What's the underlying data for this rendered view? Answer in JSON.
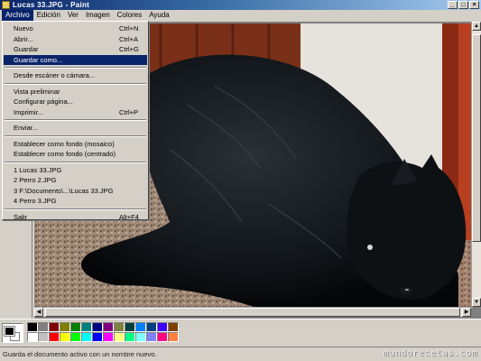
{
  "window": {
    "title": "Lucas 33.JPG - Paint",
    "minimize": "_",
    "maximize": "□",
    "close": "×"
  },
  "menubar": [
    "Archivo",
    "Edición",
    "Ver",
    "Imagen",
    "Colores",
    "Ayuda"
  ],
  "file_menu": {
    "items": [
      {
        "label": "Nuevo",
        "shortcut": "Ctrl+N"
      },
      {
        "label": "Abrir...",
        "shortcut": "Ctrl+A"
      },
      {
        "label": "Guardar",
        "shortcut": "Ctrl+G"
      },
      {
        "label": "Guardar como...",
        "shortcut": "",
        "highlight": true
      },
      {
        "sep": true
      },
      {
        "label": "Desde escáner o cámara...",
        "shortcut": ""
      },
      {
        "sep": true
      },
      {
        "label": "Vista preliminar",
        "shortcut": ""
      },
      {
        "label": "Configurar página...",
        "shortcut": ""
      },
      {
        "label": "Imprimir...",
        "shortcut": "Ctrl+P"
      },
      {
        "sep": true
      },
      {
        "label": "Enviar...",
        "shortcut": ""
      },
      {
        "sep": true
      },
      {
        "label": "Establecer como fondo (mosaico)",
        "shortcut": ""
      },
      {
        "label": "Establecer como fondo (centrado)",
        "shortcut": ""
      },
      {
        "sep": true
      },
      {
        "label": "1 Lucas 33.JPG",
        "shortcut": ""
      },
      {
        "label": "2 Perro 2.JPG",
        "shortcut": ""
      },
      {
        "label": "3 F:\\Documents\\...\\Lucas 33.JPG",
        "shortcut": ""
      },
      {
        "label": "4 Perro 3.JPG",
        "shortcut": ""
      },
      {
        "sep": true
      },
      {
        "label": "Salir",
        "shortcut": "Alt+F4"
      }
    ]
  },
  "palette": {
    "foreground": "#000000",
    "background": "#ffffff",
    "row1": [
      "#000000",
      "#808080",
      "#800000",
      "#808000",
      "#008000",
      "#008080",
      "#000080",
      "#800080",
      "#808040",
      "#004040",
      "#0080ff",
      "#004080",
      "#4000ff",
      "#804000"
    ],
    "row2": [
      "#ffffff",
      "#c0c0c0",
      "#ff0000",
      "#ffff00",
      "#00ff00",
      "#00ffff",
      "#0000ff",
      "#ff00ff",
      "#ffff80",
      "#00ff80",
      "#80ffff",
      "#8080ff",
      "#ff0080",
      "#ff8040"
    ]
  },
  "status": {
    "text": "Guarda el documento activo con un nombre nuevo.",
    "watermark": "mundorecetas.com"
  },
  "canvas": {
    "icon": "photo-of-black-dog"
  }
}
